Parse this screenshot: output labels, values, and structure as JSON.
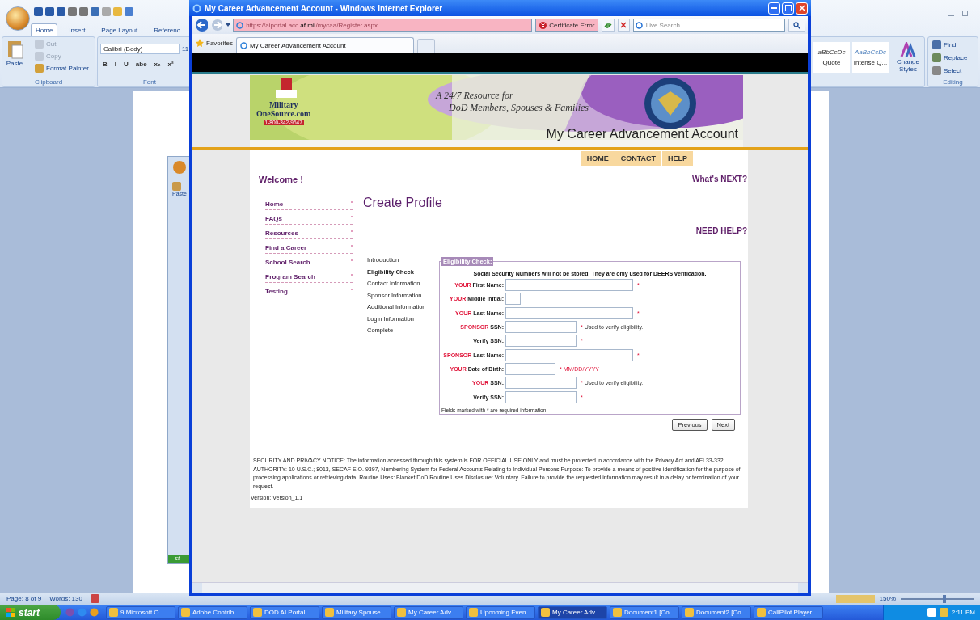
{
  "word": {
    "tabs": [
      {
        "label": "Home",
        "selected": true
      },
      {
        "label": "Insert",
        "selected": false
      },
      {
        "label": "Page Layout",
        "selected": false
      },
      {
        "label": "Referenc",
        "selected": false
      }
    ],
    "clipboard": {
      "paste": "Paste",
      "items": [
        {
          "label": "Cut",
          "disabled": true
        },
        {
          "label": "Copy",
          "disabled": true
        },
        {
          "label": "Format Painter",
          "disabled": false
        }
      ],
      "title": "Clipboard"
    },
    "font": {
      "family": "Calibri (Body)",
      "size": "11",
      "buttons": [
        "B",
        "I",
        "U",
        "abe",
        "x₂",
        "x²"
      ],
      "title": "Font"
    },
    "styles": [
      {
        "sample": "aBbCcDc",
        "name": "Quote"
      },
      {
        "sample": "AaBbCcDc",
        "name": "Intense Q..."
      }
    ],
    "change_styles": "Change Styles",
    "editing": {
      "items": [
        "Find",
        "Replace",
        "Select"
      ],
      "title": "Editing"
    },
    "inner_window": {
      "paste": "Paste",
      "start": "st"
    },
    "status": {
      "page": "Page: 8 of 9",
      "words": "Words: 130",
      "zoom": "150%",
      "zoom_slider": {
        "level": 0.6
      }
    }
  },
  "ie": {
    "title": "My Career Advancement Account - Windows Internet Explorer",
    "url": {
      "prefix": "https://aiportal.acc.",
      "host": "af.mil",
      "path": "/mycaa/Register.aspx"
    },
    "certificate": "Certificate Error",
    "search_placeholder": "Live Search",
    "favorites": "Favorites",
    "tab": "My Career Advancement Account"
  },
  "site": {
    "banner": {
      "logo_top": "Military",
      "logo_bottom": "OneSource.com",
      "phone": "1-800-342-9647",
      "tagline": [
        "A 24/7 Resource for",
        "DoD Members, Spouses & Families"
      ],
      "title": "My Career Advancement Account"
    },
    "nav": [
      "HOME",
      "CONTACT",
      "HELP"
    ],
    "welcome": "Welcome !",
    "whats_next": "What's NEXT?",
    "sidebar": [
      "Home",
      "FAQs",
      "Resources",
      "Find a Career",
      "School Search",
      "Program Search",
      "Testing"
    ],
    "heading": "Create Profile",
    "need_help": "NEED HELP?",
    "steps": [
      {
        "label": "Introduction",
        "selected": false
      },
      {
        "label": "Eligibility Check",
        "selected": true
      },
      {
        "label": "Contact Information",
        "selected": false
      },
      {
        "label": "Sponsor Information",
        "selected": false
      },
      {
        "label": "Additional Information",
        "selected": false
      },
      {
        "label": "Login Information",
        "selected": false
      },
      {
        "label": "Complete",
        "selected": false
      }
    ],
    "form": {
      "legend": "Eligibility Check:",
      "notice": "Social Security Numbers will not be stored. They are only used for DEERS verification.",
      "fields": [
        {
          "prefix": "YOUR",
          "label": "First Name:",
          "kind": "long",
          "marker": "*"
        },
        {
          "prefix": "YOUR",
          "label": "Middle Initial:",
          "kind": "tiny"
        },
        {
          "prefix": "YOUR",
          "label": "Last Name:",
          "kind": "long",
          "marker": "*"
        },
        {
          "prefix": "SPONSOR",
          "label": "SSN:",
          "kind": "medium",
          "marker": "*",
          "note": {
            "kind": "info",
            "text": "Used to verify eligibility."
          }
        },
        {
          "label": "Verify SSN:",
          "kind": "medium",
          "marker": "*"
        },
        {
          "prefix": "SPONSOR",
          "label": "Last Name:",
          "kind": "long",
          "marker": "*"
        },
        {
          "prefix": "YOUR",
          "label": "Date of Birth:",
          "kind": "date",
          "marker": "*",
          "note": {
            "kind": "format",
            "text": "MM/DD/YYYY"
          }
        },
        {
          "prefix": "YOUR",
          "label": "SSN:",
          "kind": "medium",
          "marker": "*",
          "note": {
            "kind": "info",
            "text": "Used to verify eligibility."
          }
        },
        {
          "label": "Verify SSN:",
          "kind": "medium",
          "marker": "*"
        }
      ],
      "footnote": "Fields marked with * are required information"
    },
    "buttons": [
      "Previous",
      "Next"
    ],
    "notice": [
      "SECURITY AND PRIVACY NOTICE: The information accessed through this system is FOR OFFICIAL USE ONLY and must be protected in accordance with the Privacy Act and AFI 33-332.",
      "AUTHORITY: 10 U.S.C.; 8013, SECAF E.O. 9397, Numbering System for Federal Accounts Relating to Individual Persons Purpose: To provide a means of positive identification for the purpose of processing applications or retrieving data. Routine Uses: Blanket DoD Routine Uses Disclosure: Voluntary. Failure to provide the requested information may result in a delay or termination of your request."
    ],
    "version": "Version: Version_1.1"
  },
  "taskbar": {
    "start": "start",
    "items": [
      {
        "label": "9 Microsoft O...",
        "selected": false
      },
      {
        "label": "Adobe Contrib...",
        "selected": false
      },
      {
        "label": "DOD AI Portal ...",
        "selected": false
      },
      {
        "label": "Military Spouse...",
        "selected": false
      },
      {
        "label": "My Career Adv...",
        "selected": false
      },
      {
        "label": "Upcoming Even...",
        "selected": false
      },
      {
        "label": "My Career Adv...",
        "selected": true
      },
      {
        "label": "Document1 [Co...",
        "selected": false
      },
      {
        "label": "Document2 [Co...",
        "selected": false
      },
      {
        "label": "CallPilot Player ...",
        "selected": false
      }
    ],
    "time": "2:11 PM"
  }
}
